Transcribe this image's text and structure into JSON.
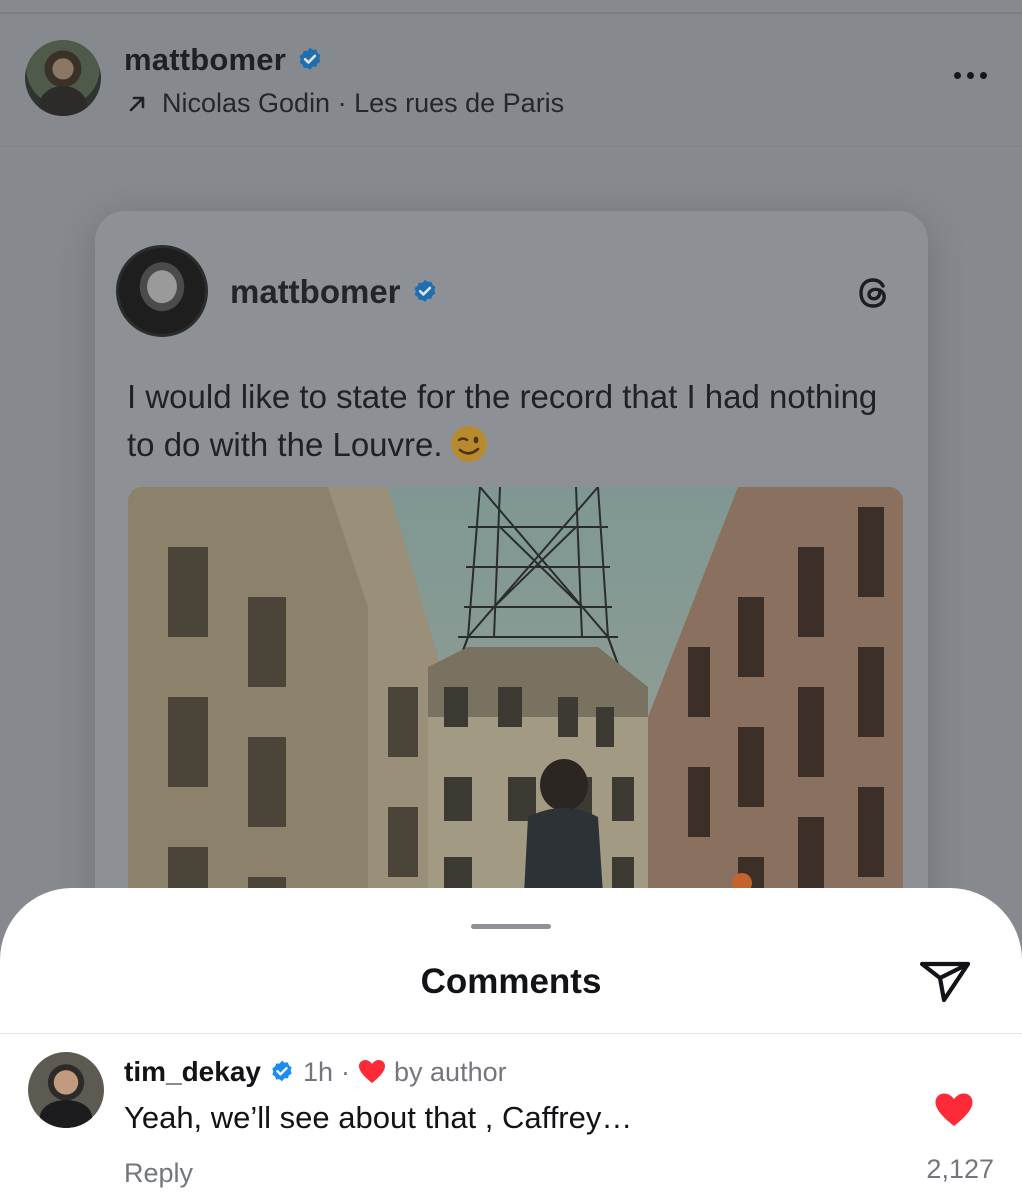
{
  "post": {
    "author": "mattbomer",
    "audio": "Nicolas Godin · Les rues de Paris",
    "icons": {
      "verified": "verified-badge-icon",
      "audio": "arrow-up-right-icon",
      "more": "more-horizontal-icon"
    }
  },
  "card": {
    "author": "mattbomer",
    "text": "I would like to state for the record that I had nothing to do with the Louvre.",
    "emoji": "winking-face-emoji",
    "icons": {
      "platform": "threads-logo-icon"
    },
    "photo": "eiffel-tower-street-photo"
  },
  "comments_sheet": {
    "title": "Comments",
    "icons": {
      "share": "send-icon"
    },
    "comment": {
      "user": "tim_dekay",
      "time": "1h",
      "separator": "·",
      "liked_by": "by author",
      "text": "Yeah, we’ll see about that , Caffrey…",
      "reply_label": "Reply",
      "like_count": "2,127"
    }
  },
  "colors": {
    "verified": "#1d8cf0",
    "heart": "#ff2a37",
    "overlay": "#868a8e"
  }
}
